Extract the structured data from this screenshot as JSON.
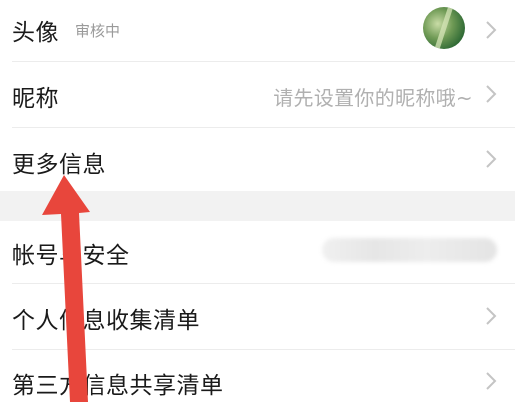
{
  "rows": {
    "avatar": {
      "label": "头像",
      "status": "审核中"
    },
    "nickname": {
      "label": "昵称",
      "placeholder": "请先设置你的昵称哦~"
    },
    "more_info": {
      "label": "更多信息"
    },
    "account_security": {
      "label": "帐号与安全"
    },
    "personal_info_list": {
      "label": "个人信息收集清单"
    },
    "third_party_list": {
      "label": "第三方信息共享清单"
    }
  },
  "colors": {
    "annotation_arrow": "#e8463c",
    "section_gap": "#f2f2f2",
    "chevron": "#c4c4c4"
  },
  "icons": {
    "chevron": "chevron-right-icon",
    "annotation": "red-arrow-annotation"
  }
}
